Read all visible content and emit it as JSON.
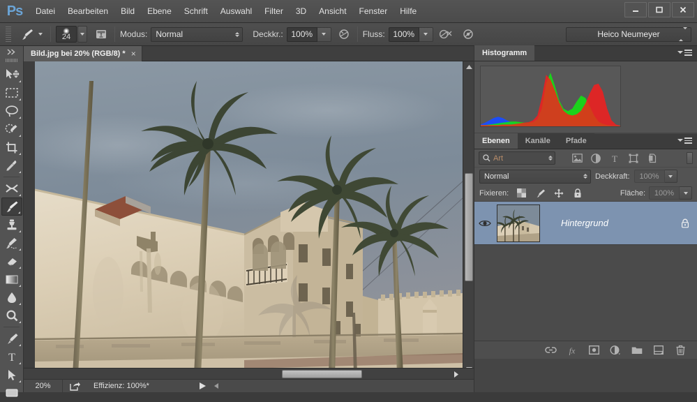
{
  "app": {
    "logo": "Ps"
  },
  "menubar": {
    "items": [
      {
        "label": "Datei"
      },
      {
        "label": "Bearbeiten"
      },
      {
        "label": "Bild"
      },
      {
        "label": "Ebene"
      },
      {
        "label": "Schrift"
      },
      {
        "label": "Auswahl"
      },
      {
        "label": "Filter"
      },
      {
        "label": "3D"
      },
      {
        "label": "Ansicht"
      },
      {
        "label": "Fenster"
      },
      {
        "label": "Hilfe"
      }
    ],
    "window_controls": {
      "minimize": "minimize-icon",
      "maximize": "maximize-icon",
      "close": "close-icon"
    }
  },
  "options_bar": {
    "tool_icon": "brush-icon",
    "brush_size": "24",
    "brush_panel_icon": "brush-panel-icon",
    "mode_label": "Modus:",
    "mode_value": "Normal",
    "opacity_label": "Deckkr.:",
    "opacity_value": "100%",
    "airbrush_icon": "airbrush-icon",
    "flow_label": "Fluss:",
    "flow_value": "100%",
    "smoothing_icon": "tablet-pressure-size-icon",
    "pressure_icon": "tablet-pressure-opacity-icon",
    "workspace": "Heico Neumeyer"
  },
  "toolbar": {
    "tools": [
      {
        "name": "move-tool",
        "label": "Verschieben"
      },
      {
        "name": "marquee-tool",
        "label": "Auswahlrechteck"
      },
      {
        "name": "lasso-tool",
        "label": "Lasso"
      },
      {
        "name": "quick-selection-tool",
        "label": "Schnellauswahl"
      },
      {
        "name": "crop-tool",
        "label": "Freistellen"
      },
      {
        "name": "eyedropper-tool",
        "label": "Pipette"
      },
      {
        "name": "healing-brush-tool",
        "label": "Reparatur-Pinsel"
      },
      {
        "name": "brush-tool",
        "label": "Pinsel",
        "active": true
      },
      {
        "name": "clone-stamp-tool",
        "label": "Kopierstempel"
      },
      {
        "name": "history-brush-tool",
        "label": "Protokollpinsel"
      },
      {
        "name": "eraser-tool",
        "label": "Radiergummi"
      },
      {
        "name": "gradient-tool",
        "label": "Verlauf"
      },
      {
        "name": "blur-tool",
        "label": "Weichzeichner"
      },
      {
        "name": "zoom-tool",
        "label": "Zoom"
      },
      {
        "name": "pen-tool",
        "label": "Zeichenstift"
      },
      {
        "name": "type-tool",
        "label": "Text"
      },
      {
        "name": "path-selection-tool",
        "label": "Pfadauswahl"
      },
      {
        "name": "shape-tool",
        "label": "Form"
      }
    ]
  },
  "document": {
    "tab_title": "Bild.jpg bei 20% (RGB/8) *",
    "close_label": "×"
  },
  "statusbar": {
    "zoom": "20%",
    "share_icon": "share-icon",
    "efficiency": "Effizienz: 100%*",
    "play_icon": "play-arrow-icon",
    "resize_icon": "resize-grip-icon"
  },
  "histogram_panel": {
    "tab": "Histogramm",
    "menu_icon": "panel-menu-icon"
  },
  "chart_data": {
    "type": "area",
    "title": "Histogramm",
    "xlabel": "",
    "ylabel": "",
    "xlim": [
      0,
      255
    ],
    "ylim": [
      0,
      100
    ],
    "grid": false,
    "legend": "none",
    "series": [
      {
        "name": "Rot",
        "color": "#ff1a1a",
        "x": [
          0,
          8,
          16,
          24,
          32,
          40,
          48,
          56,
          64,
          72,
          80,
          88,
          96,
          104,
          112,
          120,
          128,
          136,
          144,
          152,
          160,
          168,
          176,
          184,
          192,
          200,
          208,
          216,
          224,
          232,
          240,
          248,
          255
        ],
        "values": [
          2,
          2,
          2,
          2,
          2,
          3,
          3,
          3,
          4,
          5,
          6,
          7,
          10,
          18,
          48,
          86,
          78,
          60,
          40,
          26,
          20,
          18,
          20,
          26,
          38,
          55,
          70,
          72,
          58,
          30,
          10,
          3,
          1
        ]
      },
      {
        "name": "Grün",
        "color": "#12e212",
        "x": [
          0,
          8,
          16,
          24,
          32,
          40,
          48,
          56,
          64,
          72,
          80,
          88,
          96,
          104,
          112,
          120,
          128,
          136,
          144,
          152,
          160,
          168,
          176,
          184,
          192,
          200,
          208,
          216,
          224,
          232,
          240,
          248,
          255
        ],
        "values": [
          2,
          2,
          3,
          4,
          5,
          6,
          7,
          8,
          8,
          7,
          6,
          6,
          7,
          12,
          30,
          72,
          90,
          68,
          44,
          30,
          26,
          30,
          42,
          52,
          48,
          34,
          18,
          8,
          4,
          2,
          1,
          1,
          1
        ]
      },
      {
        "name": "Blau",
        "color": "#1a4dff",
        "x": [
          0,
          8,
          16,
          24,
          32,
          40,
          48,
          56,
          64,
          72,
          80,
          88,
          96,
          104,
          112,
          120,
          128,
          136,
          144,
          152,
          160,
          168,
          176,
          184,
          192,
          200,
          208,
          216,
          224,
          232,
          240,
          248,
          255
        ],
        "values": [
          3,
          6,
          10,
          14,
          16,
          14,
          10,
          7,
          5,
          4,
          4,
          5,
          7,
          14,
          36,
          74,
          92,
          80,
          52,
          28,
          14,
          7,
          4,
          3,
          2,
          2,
          2,
          1,
          1,
          1,
          1,
          1,
          1
        ]
      }
    ]
  },
  "layers_panel": {
    "tabs": [
      {
        "label": "Ebenen",
        "active": true
      },
      {
        "label": "Kanäle",
        "active": false
      },
      {
        "label": "Pfade",
        "active": false
      }
    ],
    "menu_icon": "panel-menu-icon",
    "filter": {
      "search_icon": "search-icon",
      "kind_value": "Art",
      "icons": [
        {
          "name": "filter-pixel-icon"
        },
        {
          "name": "filter-adjustment-icon"
        },
        {
          "name": "filter-type-icon"
        },
        {
          "name": "filter-shape-icon"
        },
        {
          "name": "filter-smartobject-icon"
        }
      ],
      "toggle_name": "filter-enable-toggle"
    },
    "blend_mode": "Normal",
    "opacity_label": "Deckkraft:",
    "opacity_value": "100%",
    "lock_label": "Fixieren:",
    "lock_icons": [
      {
        "name": "lock-transparent-pixels-icon"
      },
      {
        "name": "lock-image-pixels-icon"
      },
      {
        "name": "lock-position-icon"
      },
      {
        "name": "lock-all-icon"
      }
    ],
    "fill_label": "Fläche:",
    "fill_value": "100%",
    "layers": [
      {
        "name": "Hintergrund",
        "visible": true,
        "locked": true,
        "selected": true,
        "eye_icon": "eye-icon",
        "lock_icon": "lock-icon"
      }
    ],
    "footer_icons": [
      {
        "name": "link-layers-icon"
      },
      {
        "name": "layer-style-fx-icon"
      },
      {
        "name": "add-layer-mask-icon"
      },
      {
        "name": "adjustment-layer-icon"
      },
      {
        "name": "new-group-icon"
      },
      {
        "name": "new-layer-icon"
      },
      {
        "name": "delete-layer-icon"
      }
    ]
  },
  "image": {
    "description": "Historische weiße Festung mit Palmen vor blaugrauem Himmel",
    "sky_color": "#7b8a99",
    "wall_color": "#ddd0b8"
  }
}
